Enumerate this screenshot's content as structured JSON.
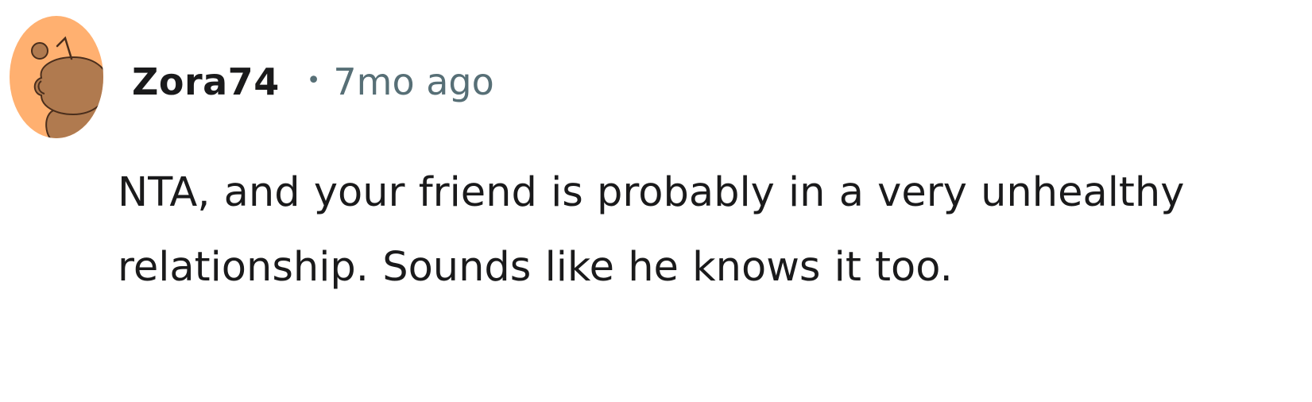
{
  "comment": {
    "author": "Zora74",
    "separator": "•",
    "timestamp": "7mo ago",
    "body": "NTA, and your friend is probably in a very unhealthy relationship. Sounds like he knows it too."
  },
  "avatar": {
    "icon": "snoo-avatar-icon",
    "background_color": "#ffb070",
    "figure_color": "#b07a4f"
  }
}
